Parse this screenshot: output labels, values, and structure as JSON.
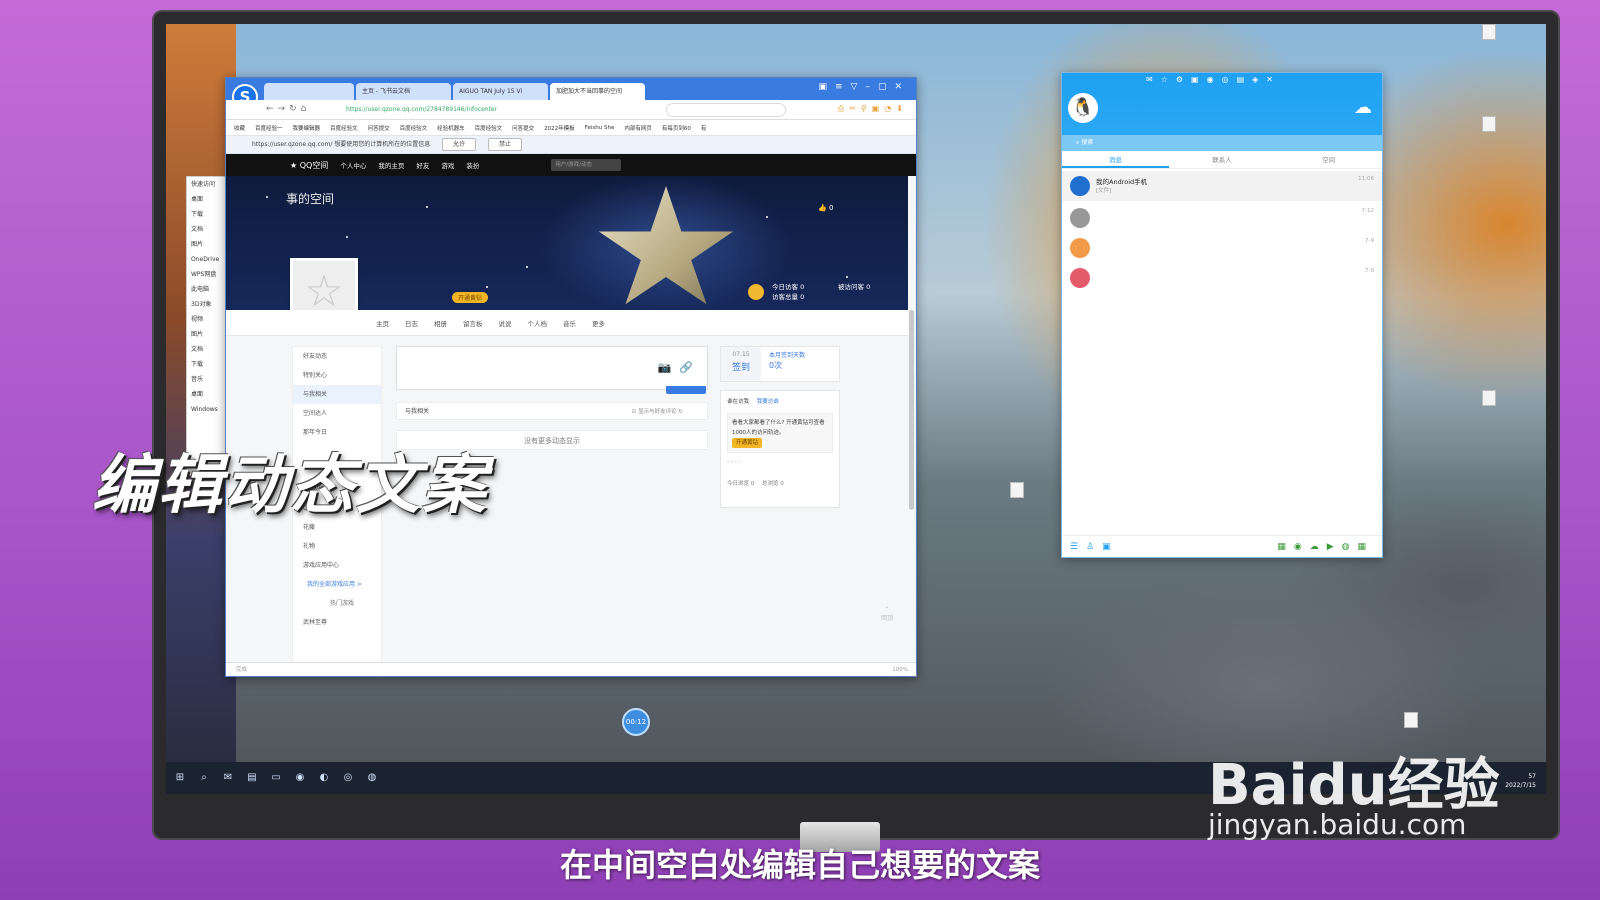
{
  "browser": {
    "tabs": [
      "主页 - 飞书云文档",
      "AIGUO TAN July 15 Vi",
      "加肥加大不当回事的空间"
    ],
    "url": "https://user.qzone.qq.com/2784789146/infocenter",
    "notice": "https://user.qzone.qq.com/ 想要使用您的计算机所在的位置信息",
    "notice_allow": "允许",
    "notice_deny": "禁止",
    "bookmarks": [
      "收藏",
      "百度经验一",
      "我要编辑器",
      "百度经验文",
      "问答提交",
      "百度经验文",
      "经验机器车",
      "百度经验文",
      "问答提交",
      "2022年模板",
      "Feishu She",
      "内部有网页",
      "有每页到60",
      "有"
    ]
  },
  "qzone": {
    "brand": "QQ空间",
    "nav": [
      "个人中心",
      "我的主页",
      "好友",
      "游戏",
      "装扮"
    ],
    "search_placeholder": "用户/游戏/动态",
    "space_title": "事的空间",
    "likes": "0",
    "today_visits": "今日访客 0",
    "total_visits": "访客总量 0",
    "visitors_stat": "被访问客 0",
    "vip_button": "开通黄钻",
    "tabs": [
      "主页",
      "日志",
      "相册",
      "留言板",
      "说说",
      "个人档",
      "音乐",
      "更多"
    ],
    "side_menu": [
      "好友动态",
      "特别关心",
      "与我相关",
      "空间达人",
      "那年今日",
      "QQ农场",
      "QQ牧场",
      "花藤",
      "礼物",
      "游戏应用中心"
    ],
    "side_menu_link": "我的全部游戏应用 >",
    "side_menu_hot": "热门游戏",
    "side_menu_game": "武林至尊",
    "filter_label": "与我相关",
    "filter_option": "显示与好友评论",
    "empty_text": "没有更多动态显示",
    "signin_date": "07.15",
    "signin_label": "签到",
    "signin_month": "本月签到天数",
    "signin_count": "0次",
    "card_title": "谁在访我",
    "card_link": "我要访谁",
    "card_note": "看看大家都看了什么? 开通黄钻可查看1000人的访问轨迹。",
    "card_vip": "开通黄钻",
    "card_today": "今日浏览",
    "card_today_val": "0",
    "card_total": "总浏览",
    "card_total_val": "0",
    "status_left": "完成",
    "status_right": "100%",
    "back_top": "回顶"
  },
  "qq": {
    "search_placeholder": "搜索",
    "tabs": [
      "消息",
      "联系人",
      "空间"
    ],
    "contacts": [
      {
        "name": "我的Android手机",
        "sub": "[文件]",
        "time": "11:06",
        "color": "#1f6fd1"
      },
      {
        "name": "",
        "sub": "",
        "time": "7-12",
        "color": "#999999"
      },
      {
        "name": "",
        "sub": "",
        "time": "7-9",
        "color": "#f29a4a"
      },
      {
        "name": "",
        "sub": "",
        "time": "7-9",
        "color": "#e35b6a"
      }
    ]
  },
  "desktop": {
    "timer": "00:12",
    "tray_time": "2022/7/15",
    "tray_clock": "57",
    "explorer_items": [
      "快速访问",
      "桌面",
      "下载",
      "文档",
      "图片",
      "OneDrive",
      "WPS网盘",
      "此电脑",
      "3D对象",
      "视频",
      "图片",
      "文档",
      "下载",
      "音乐",
      "桌面",
      "Windows"
    ]
  },
  "overlay": {
    "big_caption": "编辑动态文案",
    "subtitle": "在中间空白处编辑自己想要的文案",
    "watermark": "Baidu经验",
    "watermark_url": "jingyan.baidu.com"
  }
}
